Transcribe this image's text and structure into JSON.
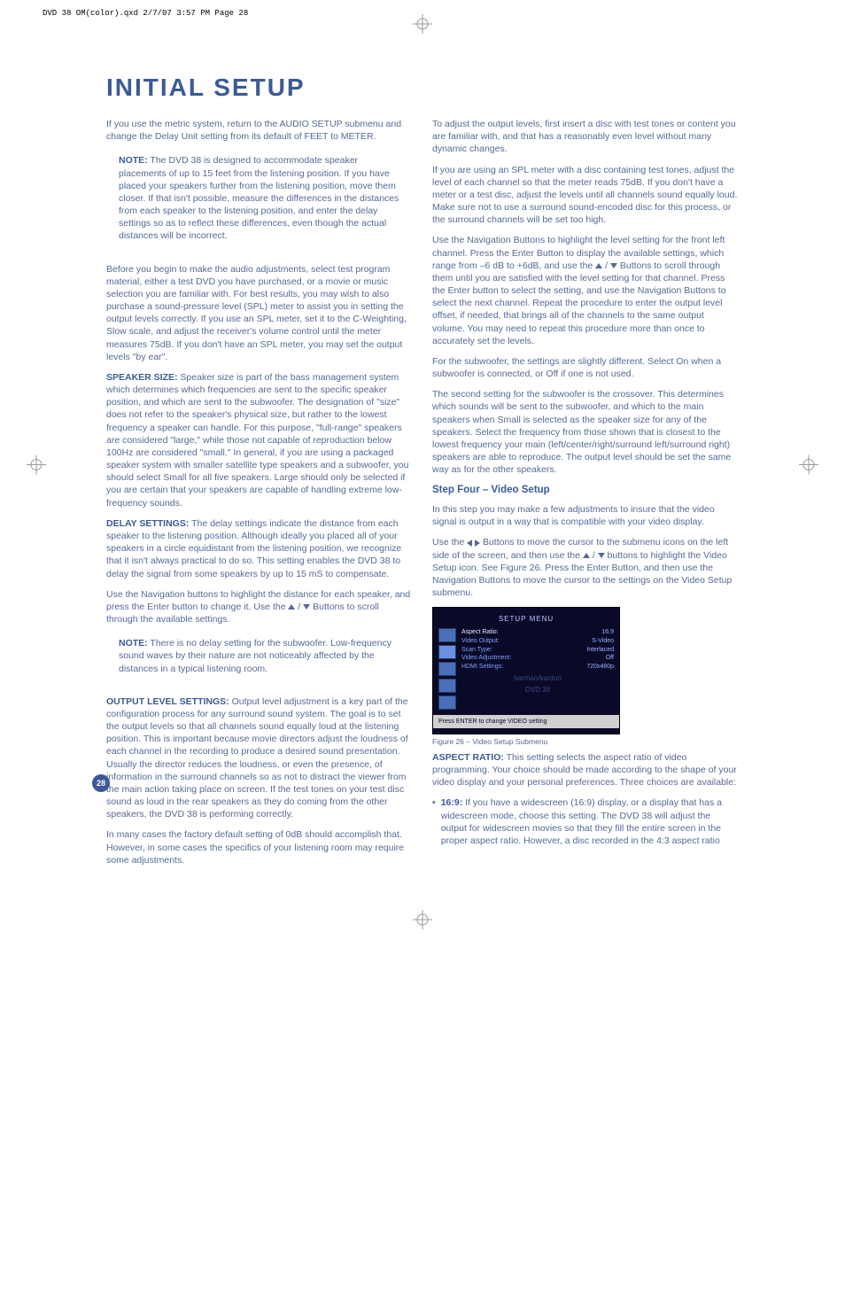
{
  "header_line": "DVD 38 OM(color).qxd  2/7/07  3:57 PM  Page 28",
  "title": "INITIAL SETUP",
  "page_number": "28",
  "left": {
    "p1": "If you use the metric system, return to the AUDIO SETUP submenu and change the Delay Unit setting from its default of FEET to METER.",
    "note1_label": "NOTE:",
    "note1": " The DVD 38 is designed to accommodate speaker placements of up to 15 feet from the listening position. If you have placed your speakers further from the listening position, move them closer. If that isn't possible, measure the differences in the distances from each speaker to the listening position, and enter the delay settings so as to reflect these differences, even though the actual distances will be incorrect.",
    "p2": "Before you begin to make the audio adjustments, select test program material, either a test DVD you have purchased, or a movie or music selection you are familiar with. For best results, you may wish to also purchase a sound-pressure level (SPL) meter to assist you in setting the output levels correctly. If you use an SPL meter, set it to the C-Weighting, Slow scale, and adjust the receiver's volume control until the meter measures 75dB. If you don't have an SPL meter, you may set the output levels \"by ear\".",
    "speaker_label": "SPEAKER SIZE:",
    "speaker": " Speaker size is part of the bass management system which determines which frequencies are sent to the specific speaker position, and which are sent to the subwoofer. The designation of \"size\" does not refer to the speaker's physical size, but rather to the lowest frequency a speaker can handle. For this purpose, \"full-range\" speakers are considered \"large,\" while those not capable of reproduction below 100Hz are considered \"small.\" In general, if you are using a packaged speaker system with smaller satellite type speakers and a subwoofer, you should select Small for all five speakers. Large should only be selected if you are certain that your speakers are capable of handling extreme low-frequency sounds.",
    "delay_label": "DELAY SETTINGS:",
    "delay": " The delay settings indicate the distance from each speaker to the listening position. Although ideally you placed all of your speakers in a circle equidistant from the listening position, we recognize that it isn't always practical to do so. This setting enables the DVD 38 to delay the signal from some speakers by up to 15 mS to compensate.",
    "p3a": "Use the Navigation buttons to highlight the distance for each speaker, and press the Enter button to change it. Use the ",
    "p3b": " Buttons to scroll through the available settings.",
    "note2_label": "NOTE:",
    "note2": " There is no delay setting for the subwoofer. Low-frequency sound waves by their nature are not noticeably affected by the distances in a typical listening room.",
    "output_label": "OUTPUT LEVEL SETTINGS:",
    "output": " Output level adjustment is a key part of the configuration process for any surround sound system. The goal is to set the output levels so that all channels sound equally loud at the listening position. This is important because movie directors adjust the loudness of each channel in the recording to produce a desired sound presentation. Usually the director reduces the loudness, or even the presence, of information in the surround channels so as not to distract the viewer from the main action taking place on screen. If the test tones on your test disc sound as loud in the rear speakers as they do coming from the other speakers, the DVD 38 is performing correctly.",
    "p4": "In many cases the factory default setting of 0dB should accomplish that. However, in some cases the specifics of your listening room may require some adjustments."
  },
  "right": {
    "p1": "To adjust the output levels, first insert a disc with test tones or content you are familiar with, and that has a reasonably even level without many dynamic changes.",
    "p2": "If you are using an SPL meter with a disc containing test tones, adjust the level of each channel so that the meter reads 75dB. If you don't have a meter or a test disc, adjust the levels until all channels sound equally loud. Make sure not to use a surround sound-encoded disc for this process, or the surround channels will be set too high.",
    "p3a": "Use the Navigation Buttons to highlight the level setting for the front left channel. Press the Enter Button to display the available settings, which range from –6 dB to +6dB, and use the ",
    "p3b": " Buttons to scroll through them until you are satisfied with the level setting for that channel. Press the Enter button to select the setting, and use the Navigation Buttons to select the next channel. Repeat the procedure to enter the output level offset, if needed, that brings all of the channels to the same output volume. You may need to repeat this procedure more than once to accurately set the levels.",
    "p4": "For the subwoofer, the settings are slightly different. Select On when a subwoofer is connected, or Off if one is not used.",
    "p5": "The second setting for the subwoofer is the crossover. This determines which sounds will be sent to the subwoofer, and which to the main speakers when Small is selected as the speaker size for any of the speakers. Select the frequency from those shown that is closest to the lowest frequency your main (left/center/right/surround left/surround right) speakers are able to reproduce. The output level should be set the same way as for the other speakers.",
    "step4_head": "Step Four – Video Setup",
    "p6": "In this step you may make a few adjustments to insure that the video signal is output in a way that is compatible with your video display.",
    "p7a": "Use the ",
    "p7b": " Buttons to move the cursor to the submenu icons on the left side of the screen, and then use the ",
    "p7c": " buttons to highlight the Video Setup icon. See Figure 26. Press the Enter Button, and then use the Navigation Buttons to move the cursor to the settings on the Video Setup submenu.",
    "fig_title": "SETUP MENU",
    "fig_rows": [
      {
        "k": "Aspect Ratio:",
        "v": "16:9"
      },
      {
        "k": "Video Output:",
        "v": "S-Video"
      },
      {
        "k": "Scan Type:",
        "v": "Interlaced"
      },
      {
        "k": "Video Adjustment:",
        "v": "Off"
      },
      {
        "k": "HDMI Settings:",
        "v": "720x480p"
      }
    ],
    "fig_brand1": "harman/kardon",
    "fig_brand2": "DVD 38",
    "fig_bottom": "Press ENTER to change VIDEO setting",
    "fig_caption": "Figure 26 – Video Setup Submenu",
    "aspect_label": "ASPECT RATIO:",
    "aspect": " This setting selects the aspect ratio of video programming. Your choice should be made according to the shape of your video display and your personal preferences. Three choices are available:",
    "b1_label": "16:9:",
    "b1": " If you have a widescreen (16:9) display, or a display that has a widescreen mode, choose this setting. The DVD 38 will adjust the output for widescreen movies so that they fill the entire screen in the proper aspect ratio. However, a disc recorded in the 4:3 aspect ratio"
  }
}
